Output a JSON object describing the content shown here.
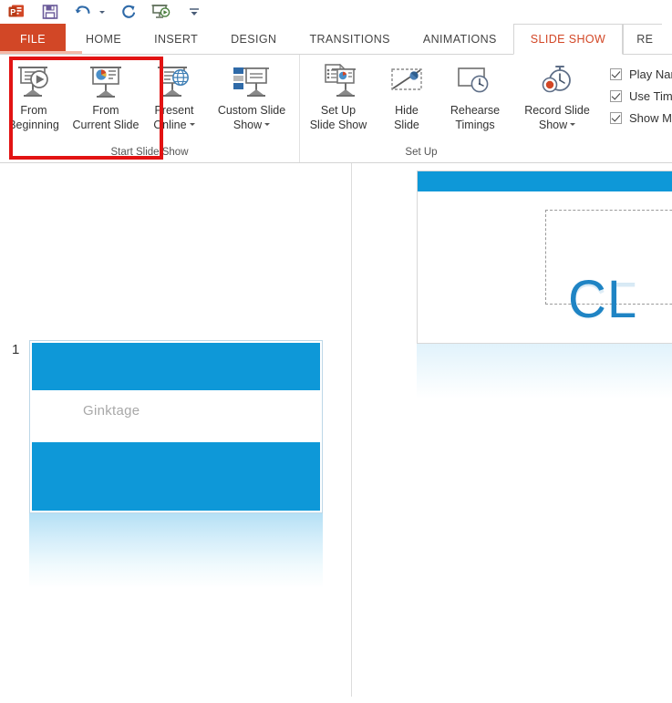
{
  "quick_access": {
    "items": [
      {
        "name": "powerpoint-logo-icon",
        "label": "PowerPoint"
      },
      {
        "name": "save-icon",
        "label": "Save"
      },
      {
        "name": "undo-icon",
        "label": "Undo",
        "has_caret": true
      },
      {
        "name": "redo-icon",
        "label": "Redo"
      },
      {
        "name": "start-from-beginning-icon",
        "label": "Start From Beginning"
      },
      {
        "name": "customize-quick-access-toolbar-icon",
        "label": "Customize Quick Access Toolbar"
      }
    ]
  },
  "tabs": [
    {
      "label": "FILE",
      "kind": "file"
    },
    {
      "label": "HOME",
      "kind": "normal"
    },
    {
      "label": "INSERT",
      "kind": "normal"
    },
    {
      "label": "DESIGN",
      "kind": "normal"
    },
    {
      "label": "TRANSITIONS",
      "kind": "normal"
    },
    {
      "label": "ANIMATIONS",
      "kind": "normal"
    },
    {
      "label": "SLIDE SHOW",
      "kind": "active"
    },
    {
      "label": "RE",
      "kind": "partial"
    }
  ],
  "ribbon": {
    "groups": [
      {
        "label": "Start Slide Show",
        "buttons": [
          {
            "label_line1": "From",
            "label_line2": "Beginning",
            "icon": "projector-play-icon"
          },
          {
            "label_line1": "From",
            "label_line2": "Current Slide",
            "icon": "projector-chart-icon"
          },
          {
            "label_line1": "Present",
            "label_line2": "Online",
            "icon": "projector-globe-icon",
            "dropdown": true
          },
          {
            "label_line1": "Custom Slide",
            "label_line2": "Show",
            "icon": "custom-slide-show-icon",
            "dropdown": true
          }
        ]
      },
      {
        "label": "Set Up",
        "buttons": [
          {
            "label_line1": "Set Up",
            "label_line2": "Slide Show",
            "icon": "setup-slide-show-icon"
          },
          {
            "label_line1": "Hide",
            "label_line2": "Slide",
            "icon": "hide-slide-icon"
          },
          {
            "label_line1": "Rehearse",
            "label_line2": "Timings",
            "icon": "rehearse-timings-icon"
          },
          {
            "label_line1": "Record Slide",
            "label_line2": "Show",
            "icon": "record-slide-show-icon",
            "dropdown": true
          }
        ],
        "checkboxes": [
          {
            "label": "Play Narrat",
            "checked": true
          },
          {
            "label": "Use Timing",
            "checked": true
          },
          {
            "label": "Show Med",
            "checked": true
          }
        ]
      }
    ]
  },
  "annotation": {
    "label": "red-highlight-around-start-slide-show-buttons",
    "color": "#e21313"
  },
  "thumbnail_pane": {
    "slides": [
      {
        "number": "1",
        "body_text": "Ginktage"
      }
    ]
  },
  "slide_editor": {
    "title_text": "CL"
  },
  "colors": {
    "file_tab": "#d24726",
    "active_tab_text": "#d24726",
    "slide_accent_blue": "#0e98d8",
    "slide_title_blue": "#1f84c4",
    "annotation_red": "#e21313"
  }
}
